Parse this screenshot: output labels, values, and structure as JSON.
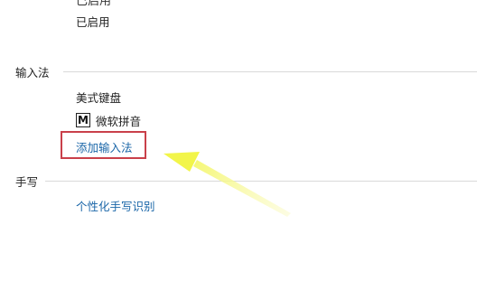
{
  "top_section": {
    "cut_heading": "已启用",
    "status": "已启用"
  },
  "input_method_section": {
    "header": "输入法",
    "keyboard_item": "美式键盘",
    "ime_icon_glyph": "M",
    "ime_item": "微软拼音",
    "add_link": "添加输入法"
  },
  "handwriting_section": {
    "header": "手写",
    "link": "个性化手写识别"
  },
  "colors": {
    "link": "#1a66a8",
    "highlight_box": "#c9404a",
    "arrow": "#f2f54a"
  }
}
